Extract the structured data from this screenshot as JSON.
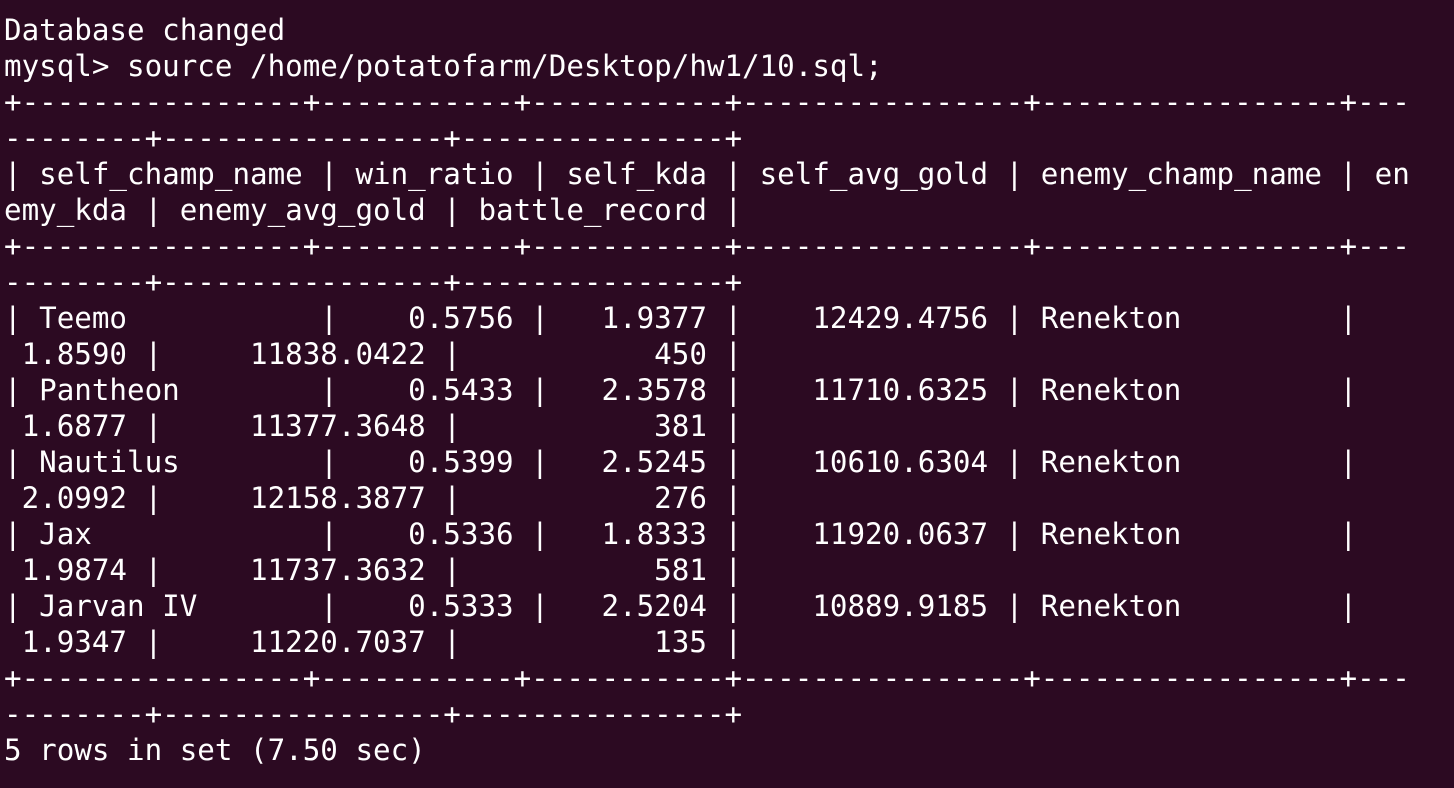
{
  "terminal": {
    "lines": [
      "Database changed",
      "mysql> source /home/potatofarm/Desktop/hw1/10.sql;",
      "+----------------+-----------+-----------+----------------+-----------------+---",
      "--------+----------------+---------------+",
      "| self_champ_name | win_ratio | self_kda | self_avg_gold | enemy_champ_name | en",
      "emy_kda | enemy_avg_gold | battle_record |",
      "+----------------+-----------+-----------+----------------+-----------------+---",
      "--------+----------------+---------------+",
      "| Teemo           |    0.5756 |   1.9377 |    12429.4756 | Renekton         |",
      " 1.8590 |     11838.0422 |           450 |",
      "| Pantheon        |    0.5433 |   2.3578 |    11710.6325 | Renekton         |",
      " 1.6877 |     11377.3648 |           381 |",
      "| Nautilus        |    0.5399 |   2.5245 |    10610.6304 | Renekton         |",
      " 2.0992 |     12158.3877 |           276 |",
      "| Jax             |    0.5336 |   1.8333 |    11920.0637 | Renekton         |",
      " 1.9874 |     11737.3632 |           581 |",
      "| Jarvan IV       |    0.5333 |   2.5204 |    10889.9185 | Renekton         |",
      " 1.9347 |     11220.7037 |           135 |",
      "+----------------+-----------+-----------+----------------+-----------------+---",
      "--------+----------------+---------------+",
      "5 rows in set (7.50 sec)"
    ]
  },
  "colors": {
    "background": "#2c0a22",
    "foreground": "#ffffff"
  }
}
